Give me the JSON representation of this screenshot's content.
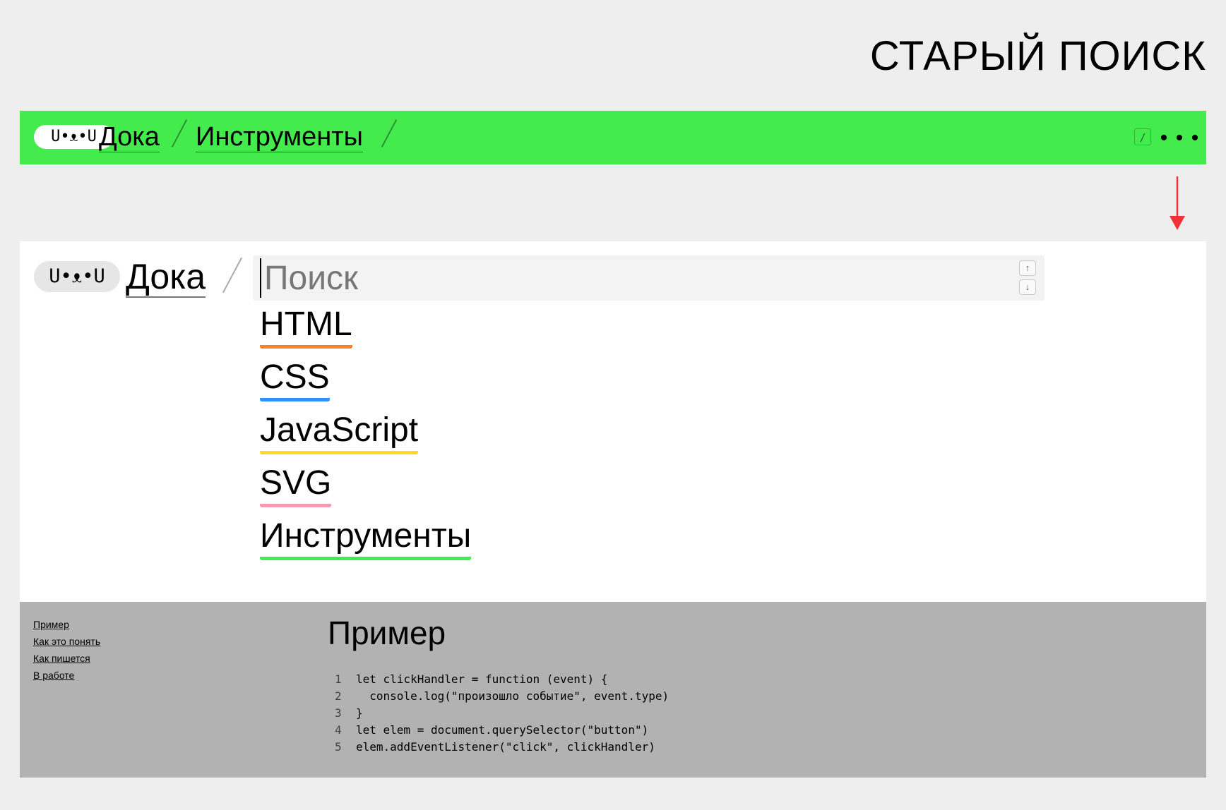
{
  "slide_title": "СТАРЫЙ ПОИСК",
  "green_header": {
    "logo": "U•ᴥ•U",
    "crumbs": [
      "Дока",
      "Инструменты"
    ],
    "slash_key": "/",
    "more_icon": "more-dots-icon",
    "background": "#44eb4c"
  },
  "arrow_color": "#f23333",
  "search": {
    "logo": "U•ᴥ•U",
    "home_crumb": "Дока",
    "placeholder": "Поиск",
    "value": "",
    "up_label": "↑",
    "down_label": "↓"
  },
  "sections": [
    {
      "label": "HTML",
      "color": "#ff7f2a"
    },
    {
      "label": "CSS",
      "color": "#2f90ff"
    },
    {
      "label": "JavaScript",
      "color": "#ffd829"
    },
    {
      "label": "SVG",
      "color": "#f49ab2"
    },
    {
      "label": "Инструменты",
      "color": "#44eb4c"
    }
  ],
  "example": {
    "toc": [
      "Пример",
      "Как это понять",
      "Как пишется",
      "В работе"
    ],
    "title": "Пример",
    "code_lines": [
      {
        "n": "1",
        "text": "let clickHandler = function (event) {"
      },
      {
        "n": "2",
        "text": "  console.log(\"произошло событие\", event.type)"
      },
      {
        "n": "3",
        "text": "}"
      },
      {
        "n": "4",
        "text": "let elem = document.querySelector(\"button\")"
      },
      {
        "n": "5",
        "text": "elem.addEventListener(\"click\", clickHandler)"
      }
    ]
  }
}
